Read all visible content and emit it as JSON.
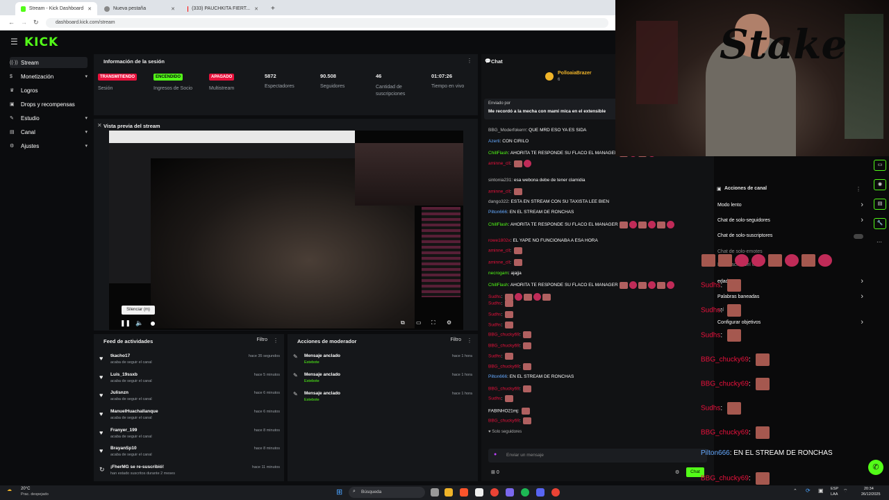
{
  "browser": {
    "tabs": [
      {
        "label": "Stream - Kick Dashboard",
        "color": "#53fc18"
      },
      {
        "label": "Nueva pestaña",
        "color": "#888888"
      },
      {
        "label": "(333) PAUCHKITA FIERT...",
        "color": "#ff0000"
      }
    ],
    "url": "dashboard.kick.com/stream"
  },
  "kick": {
    "logo": "KICK",
    "sidebar": [
      {
        "label": "Stream",
        "icon": "broadcast-icon",
        "chevron": false
      },
      {
        "label": "Monetización",
        "icon": "dollar-icon",
        "chevron": true
      },
      {
        "label": "Logros",
        "icon": "trophy-icon",
        "chevron": false
      },
      {
        "label": "Drops y recompensas",
        "icon": "gift-icon",
        "chevron": false
      },
      {
        "label": "Estudio",
        "icon": "studio-icon",
        "chevron": true
      },
      {
        "label": "Canal",
        "icon": "channel-icon",
        "chevron": true
      },
      {
        "label": "Ajustes",
        "icon": "gear-icon",
        "chevron": true
      }
    ],
    "session": {
      "title": "Información de la sesión",
      "badges": [
        {
          "badge": "TRANSMITIENDO",
          "label": "Sesión",
          "bg": "#e9113c",
          "fg": "#ffffff"
        },
        {
          "badge": "ENCENDIDO",
          "label": "Ingresos de Socio",
          "bg": "#53fc18",
          "fg": "#0b0c0e"
        },
        {
          "badge": "APAGADO",
          "label": "Multistream",
          "bg": "#e9113c",
          "fg": "#ffffff"
        }
      ],
      "stats": [
        {
          "value": "5872",
          "label": "Espectadores"
        },
        {
          "value": "90.508",
          "label": "Seguidores"
        },
        {
          "value": "46",
          "label": "Cantidad de suscripciones"
        },
        {
          "value": "01:07:26",
          "label": "Tiempo en vivo"
        }
      ]
    },
    "preview": {
      "title": "Vista previa del stream",
      "tooltip": "Silenciar (m)"
    },
    "feed": {
      "title": "Feed de actividades",
      "filter": "Filtro",
      "items": [
        {
          "user": "tkacho17",
          "sub": "acaba de seguir el canal",
          "time": "hace 35 segundos"
        },
        {
          "user": "Luis_19ssxb",
          "sub": "acaba de seguir el canal",
          "time": "hace 5 minutos"
        },
        {
          "user": "Julisnzn",
          "sub": "acaba de seguir el canal",
          "time": "hace 6 minutos"
        },
        {
          "user": "ManuelHuachallanque",
          "sub": "acaba de seguir el canal",
          "time": "hace 6 minutos"
        },
        {
          "user": "Franyer_199",
          "sub": "acaba de seguir el canal",
          "time": "hace 8 minutos"
        },
        {
          "user": "BrayanSp10",
          "sub": "acaba de seguir el canal",
          "time": "hace 8 minutos"
        },
        {
          "user": "¡FherMG se re-suscribió!",
          "sub": "han estado suscritos durante 2 meses",
          "time": "hace 11 minutos"
        }
      ]
    },
    "mod": {
      "title": "Acciones de moderador",
      "filter": "Filtro",
      "items": [
        {
          "label": "Mensaje anclado",
          "by": "Estebote",
          "time": "hace 1 hora"
        },
        {
          "label": "Mensaje anclado",
          "by": "Estebote",
          "time": "hace 1 hora"
        },
        {
          "label": "Mensaje anclado",
          "by": "Estebote",
          "time": "hace 1 hora"
        }
      ]
    },
    "chat": {
      "title": "Chat",
      "top_user": "PolloaiaBrazer",
      "top_user_count": "6",
      "pinned_by": "Enviado por",
      "pinned_msg": "Me recordó a la mecha con mami mica en el extensible",
      "messages": [
        {
          "user": "BBG_Moderfokerrr",
          "text": "QUE MRD ESO YA ES SIDA",
          "color": "#bdbdbd",
          "emotes": 0
        },
        {
          "user": "Azerti",
          "text": "CON CIRILO",
          "color": "#66aaff",
          "emotes": 0
        },
        {
          "user": "ChillFlash",
          "text": "AHORITA TE RESPONDE SU FLACO EL MANAGER",
          "color": "#53fc18",
          "emotes": 4
        },
        {
          "user": "aminne_cll",
          "text": "",
          "color": "#e9113c",
          "emotes": 2
        },
        {
          "user": "sintonia231",
          "text": "esa webona debe de tener clamidia",
          "color": "#bdbdbd",
          "emotes": 0
        },
        {
          "user": "aminne_cll",
          "text": "",
          "color": "#e9113c",
          "emotes": 1
        },
        {
          "user": "dango322",
          "text": "ESTA EN STREAM CON SU TAXISTA LEE BIEN",
          "color": "#bdbdbd",
          "emotes": 0
        },
        {
          "user": "Pilton666",
          "text": "EN EL STREAM DE RONCHAS",
          "color": "#66aaff",
          "emotes": 0
        },
        {
          "user": "ChillFlash",
          "text": "AHORITA TE RESPONDE SU FLACO EL MANAGER",
          "color": "#53fc18",
          "emotes": 6
        },
        {
          "user": "rowe1802x",
          "text": "EL YAPE NO FUNCIONABA A ESA HORA",
          "color": "#e9113c",
          "emotes": 0
        },
        {
          "user": "aminne_cll",
          "text": "",
          "color": "#e9113c",
          "emotes": 1
        },
        {
          "user": "aminne_cll",
          "text": "",
          "color": "#e9113c",
          "emotes": 1
        },
        {
          "user": "necrogam",
          "text": "ajajja",
          "color": "#53fc18",
          "emotes": 0
        },
        {
          "user": "ChillFlash",
          "text": "AHORITA TE RESPONDE SU FLACO EL MANAGER",
          "color": "#53fc18",
          "emotes": 6
        },
        {
          "user": "Sudhs",
          "text": "",
          "color": "#e9113c",
          "emotes": 5
        },
        {
          "user": "Sudhs",
          "text": "",
          "color": "#e9113c",
          "emotes": 1
        },
        {
          "user": "Sudhs",
          "text": "",
          "color": "#e9113c",
          "emotes": 1
        },
        {
          "user": "Sudhs",
          "text": "",
          "color": "#e9113c",
          "emotes": 1
        },
        {
          "user": "BBG_chucky69",
          "text": "",
          "color": "#e9113c",
          "emotes": 1
        },
        {
          "user": "BBG_chucky69",
          "text": "",
          "color": "#e9113c",
          "emotes": 1
        },
        {
          "user": "Sudhs",
          "text": "",
          "color": "#e9113c",
          "emotes": 1
        },
        {
          "user": "BBG_chucky69",
          "text": "",
          "color": "#e9113c",
          "emotes": 1
        },
        {
          "user": "Pilton666",
          "text": "EN EL STREAM DE RONCHAS",
          "color": "#66aaff",
          "emotes": 0
        },
        {
          "user": "BBG_chucky69",
          "text": "",
          "color": "#e9113c",
          "emotes": 1
        },
        {
          "user": "Sudhs",
          "text": "",
          "color": "#e9113c",
          "emotes": 1
        },
        {
          "user": "FABINHO21mj",
          "text": "",
          "color": "#ffffff",
          "emotes": 1
        },
        {
          "user": "BBG_chucky69",
          "text": "",
          "color": "#e9113c",
          "emotes": 1
        }
      ],
      "followers_only": "Solo seguidores",
      "input_placeholder": "Enviar un mensaje",
      "viewers": "0",
      "send": "Chat"
    },
    "channel_actions": {
      "title": "Acciones de canal",
      "items": [
        {
          "label": "Modo lento",
          "control": "chevron"
        },
        {
          "label": "Chat de solo-seguidores",
          "control": "chevron"
        },
        {
          "label": "Chat de solo-suscriptores",
          "control": "toggle"
        },
        {
          "label": "Chat de solo-emotes",
          "control": "none"
        },
        {
          "label": "Moderación del chat",
          "control": "none"
        },
        {
          "label": "edad",
          "control": "chevron"
        },
        {
          "label": "Palabras baneadas",
          "control": "chevron"
        },
        {
          "label": "nal",
          "control": "none"
        },
        {
          "label": "Configurar objetivos",
          "control": "chevron"
        }
      ]
    },
    "overlay": {
      "brand": "Stake",
      "messages": [
        {
          "user": "Sudhs",
          "text": "",
          "emotes": 1
        },
        {
          "user": "Sudhs",
          "text": "",
          "emotes": 1
        },
        {
          "user": "Sudhs",
          "text": "",
          "emotes": 1
        },
        {
          "user": "BBG_chucky69",
          "text": "",
          "emotes": 1
        },
        {
          "user": "BBG_chucky69",
          "text": "",
          "emotes": 1
        },
        {
          "user": "Sudhs",
          "text": "",
          "emotes": 1
        },
        {
          "user": "BBG_chucky69",
          "text": "",
          "emotes": 1
        },
        {
          "user": "Pilton666",
          "text": "EN EL STREAM DE RONCHAS",
          "emotes": 0
        },
        {
          "user": "BBG_chucky69",
          "text": "",
          "emotes": 1
        }
      ]
    }
  },
  "taskbar": {
    "weather_temp": "20°C",
    "weather_desc": "Prac. despejado",
    "search_placeholder": "Búsqueda",
    "lang": "ESP",
    "lang2": "LAA",
    "time": "20:34",
    "date": "26/12/2025"
  }
}
